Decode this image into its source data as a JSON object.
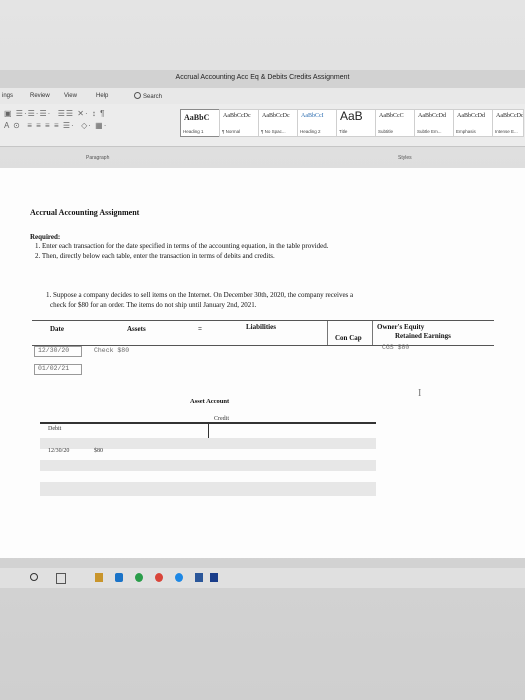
{
  "window": {
    "title": "Accrual Accounting Acc Eq & Debits Credits Assignment"
  },
  "menu": {
    "items": [
      "ings",
      "Review",
      "View",
      "Help"
    ],
    "search_label": "Search"
  },
  "ribbon": {
    "styles": [
      {
        "sample": "AaBbC",
        "name": "Heading 1"
      },
      {
        "sample": "AaBbCcDc",
        "name": "¶ Normal"
      },
      {
        "sample": "AaBbCcDc",
        "name": "¶ No Spac..."
      },
      {
        "sample": "AaBbCcI",
        "name": "Heading 2"
      },
      {
        "sample": "AaB",
        "name": "Title"
      },
      {
        "sample": "AaBbCcC",
        "name": "Subtitle"
      },
      {
        "sample": "AaBbCcDd",
        "name": "Subtle Em..."
      },
      {
        "sample": "AaBbCcDd",
        "name": "Emphasis"
      },
      {
        "sample": "AaBbCcDd",
        "name": "Intense E..."
      }
    ],
    "paragraph_label": "Paragraph",
    "styles_label": "Styles"
  },
  "doc": {
    "heading": "Accrual Accounting Assignment",
    "required": "Required:",
    "instructions": [
      "1.  Enter each transaction for the date specified in terms of the accounting equation, in the table provided.",
      "2.  Then, directly below each table, enter the transaction in terms of debits and credits."
    ],
    "question_line1": "1.  Suppose a company decides to sell items on the Internet.  On December 30th, 2020, the company receives a",
    "question_line2": "check for $80 for an order.  The items do not ship until January 2nd, 2021.",
    "table": {
      "date_header": "Date",
      "assets_header": "Assets",
      "equals": "=",
      "liabilities_header": "Liabilities",
      "owners_equity": "Owner's Equity",
      "con_cap": "Con Cap",
      "retained_earnings": "Retained Earnings",
      "rows": [
        {
          "date": "12/30/20",
          "asset": "Check $80",
          "re": "CGS $80"
        },
        {
          "date": "01/02/21",
          "asset": "",
          "re": ""
        }
      ]
    },
    "t_account": {
      "title": "Asset Account",
      "debit": "Debit",
      "credit": "Credit",
      "entry_date": "12/30/20",
      "entry_amount": "$80"
    }
  },
  "colors": {
    "page": "#fdfdfd",
    "ribbon": "#ececec",
    "accent_blue": "#2b6cb0"
  }
}
